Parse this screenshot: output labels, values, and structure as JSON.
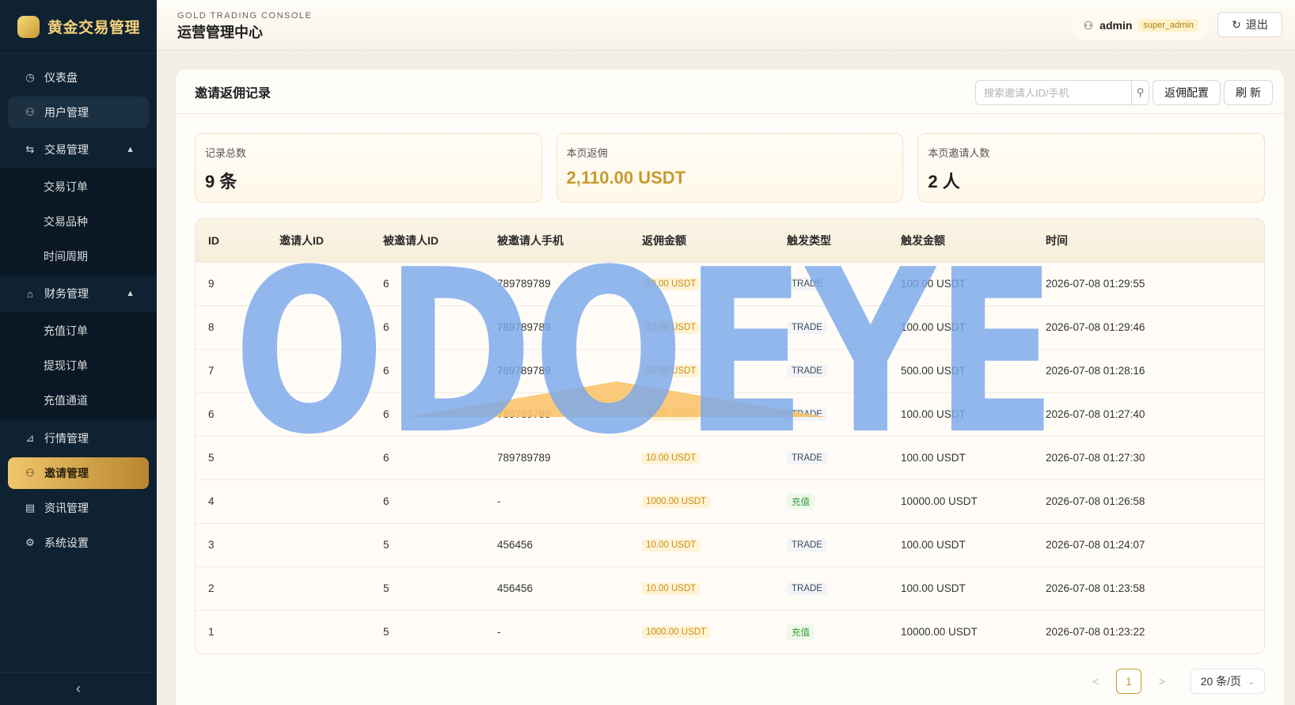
{
  "sidebar": {
    "brand": "黄金交易管理",
    "items": [
      {
        "label": "仪表盘",
        "icon": "dashboard-icon"
      },
      {
        "label": "用户管理",
        "icon": "user-icon"
      },
      {
        "label": "交易管理",
        "icon": "swap-icon",
        "children": [
          "交易订单",
          "交易品种",
          "时间周期"
        ]
      },
      {
        "label": "财务管理",
        "icon": "bank-icon",
        "children": [
          "充值订单",
          "提现订单",
          "充值通道"
        ]
      },
      {
        "label": "行情管理",
        "icon": "chart-icon"
      },
      {
        "label": "邀请管理",
        "icon": "invite-icon"
      },
      {
        "label": "资讯管理",
        "icon": "document-icon"
      },
      {
        "label": "系统设置",
        "icon": "gear-icon"
      }
    ],
    "collapse_label": "‹"
  },
  "header": {
    "subtitle": "GOLD TRADING CONSOLE",
    "title": "运营管理中心",
    "user": "admin",
    "role": "super_admin",
    "logout": "退出"
  },
  "panel": {
    "title": "邀请返佣记录",
    "search_placeholder": "搜索邀请人ID/手机",
    "config_label": "返佣配置",
    "refresh_label": "刷 新"
  },
  "stats": [
    {
      "label": "记录总数",
      "value": "9 条"
    },
    {
      "label": "本页返佣",
      "value": "2,110.00 USDT"
    },
    {
      "label": "本页邀请人数",
      "value": "2 人"
    }
  ],
  "table": {
    "columns": [
      "ID",
      "邀请人ID",
      "被邀请人ID",
      "被邀请人手机",
      "返佣金额",
      "触发类型",
      "触发金额",
      "时间"
    ],
    "rows": [
      {
        "id": "9",
        "inviter": "",
        "invitee": "6",
        "phone": "789789789",
        "amount": "10.00 USDT",
        "type": "TRADE",
        "trigger": "100.00 USDT",
        "time": "2026-07-08 01:29:55"
      },
      {
        "id": "8",
        "inviter": "",
        "invitee": "6",
        "phone": "789789789",
        "amount": "10.00 USDT",
        "type": "TRADE",
        "trigger": "100.00 USDT",
        "time": "2026-07-08 01:29:46"
      },
      {
        "id": "7",
        "inviter": "",
        "invitee": "6",
        "phone": "789789789",
        "amount": "50.00 USDT",
        "type": "TRADE",
        "trigger": "500.00 USDT",
        "time": "2026-07-08 01:28:16"
      },
      {
        "id": "6",
        "inviter": "",
        "invitee": "6",
        "phone": "789789789",
        "amount": "10.00 USDT",
        "type": "TRADE",
        "trigger": "100.00 USDT",
        "time": "2026-07-08 01:27:40"
      },
      {
        "id": "5",
        "inviter": "",
        "invitee": "6",
        "phone": "789789789",
        "amount": "10.00 USDT",
        "type": "TRADE",
        "trigger": "100.00 USDT",
        "time": "2026-07-08 01:27:30"
      },
      {
        "id": "4",
        "inviter": "",
        "invitee": "6",
        "phone": "-",
        "amount": "1000.00 USDT",
        "type": "充值",
        "trigger": "10000.00 USDT",
        "time": "2026-07-08 01:26:58"
      },
      {
        "id": "3",
        "inviter": "",
        "invitee": "5",
        "phone": "456456",
        "amount": "10.00 USDT",
        "type": "TRADE",
        "trigger": "100.00 USDT",
        "time": "2026-07-08 01:24:07"
      },
      {
        "id": "2",
        "inviter": "",
        "invitee": "5",
        "phone": "456456",
        "amount": "10.00 USDT",
        "type": "TRADE",
        "trigger": "100.00 USDT",
        "time": "2026-07-08 01:23:58"
      },
      {
        "id": "1",
        "inviter": "",
        "invitee": "5",
        "phone": "-",
        "amount": "1000.00 USDT",
        "type": "充值",
        "trigger": "10000.00 USDT",
        "time": "2026-07-08 01:23:22"
      }
    ]
  },
  "pagination": {
    "current": "1",
    "prev": "<",
    "next": ">",
    "page_size": "20 条/页"
  },
  "watermark": {
    "text": "ODOEYE",
    "color": "#7aa7ea",
    "accent": "#f9c46b"
  },
  "colors": {
    "sidebar_bg": "#0f2231",
    "gold_accent": "#c79a2f",
    "active_nav": "#f0c66a"
  }
}
